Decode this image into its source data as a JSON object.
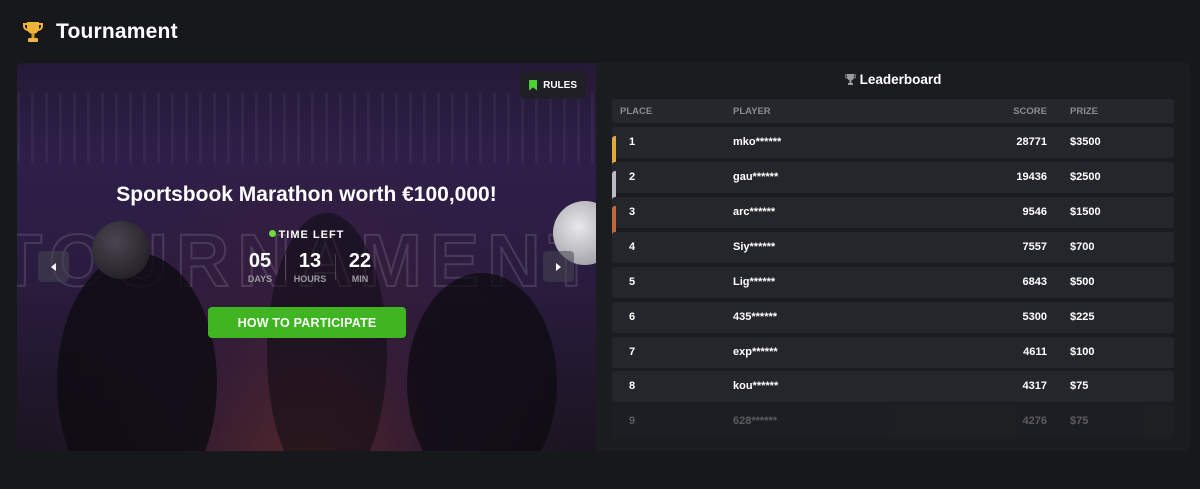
{
  "section": {
    "title": "Tournament",
    "icon": "trophy-icon"
  },
  "banner": {
    "rules_label": "RULES",
    "title": "Sportsbook Marathon worth €100,000!",
    "time_left_label": "TIME LEFT",
    "countdown": [
      {
        "value": "05",
        "label": "DAYS"
      },
      {
        "value": "13",
        "label": "HOURS"
      },
      {
        "value": "22",
        "label": "MIN"
      }
    ],
    "cta_label": "HOW TO PARTICIPATE",
    "accent_color": "#3fb621"
  },
  "leaderboard": {
    "title": "Leaderboard",
    "columns": {
      "place": "PLACE",
      "player": "PLAYER",
      "score": "SCORE",
      "prize": "PRIZE"
    },
    "rank_colors": [
      "#e3a83c",
      "#b9bcc4",
      "#c0693a"
    ],
    "rows": [
      {
        "place": "1",
        "player": "mko******",
        "score": "28771",
        "prize": "$3500"
      },
      {
        "place": "2",
        "player": "gau******",
        "score": "19436",
        "prize": "$2500"
      },
      {
        "place": "3",
        "player": "arc******",
        "score": "9546",
        "prize": "$1500"
      },
      {
        "place": "4",
        "player": "Siy******",
        "score": "7557",
        "prize": "$700"
      },
      {
        "place": "5",
        "player": "Lig******",
        "score": "6843",
        "prize": "$500"
      },
      {
        "place": "6",
        "player": "435******",
        "score": "5300",
        "prize": "$225"
      },
      {
        "place": "7",
        "player": "exp******",
        "score": "4611",
        "prize": "$100"
      },
      {
        "place": "8",
        "player": "kou******",
        "score": "4317",
        "prize": "$75"
      },
      {
        "place": "9",
        "player": "628******",
        "score": "4276",
        "prize": "$75"
      }
    ]
  }
}
